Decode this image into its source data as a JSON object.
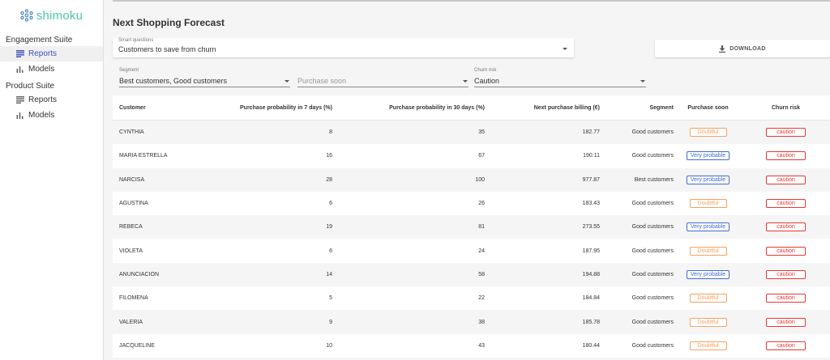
{
  "app": {
    "logo_text": "shimoku"
  },
  "sidebar": {
    "suites": [
      {
        "title": "Engagement Suite",
        "items": [
          {
            "label": "Reports"
          },
          {
            "label": "Models"
          }
        ]
      },
      {
        "title": "Product Suite",
        "items": [
          {
            "label": "Reports"
          },
          {
            "label": "Models"
          }
        ]
      }
    ]
  },
  "page": {
    "title": "Next Shopping Forecast",
    "smart_questions": {
      "label": "Smart questions",
      "value": "Customers to save from churn"
    },
    "download_label": "DOWNLOAD",
    "filters": {
      "segment": {
        "label": "Segment",
        "value": "Best customers, Good customers"
      },
      "purchase_soon": {
        "placeholder": "Purchase soon"
      },
      "churn_risk": {
        "label": "Churn risk",
        "value": "Caution"
      }
    }
  },
  "table": {
    "headers": [
      "Customer",
      "Purchase probability in 7 days (%)",
      "Purchase probability in 30 days (%)",
      "Next purchase billing (€)",
      "Segment",
      "Purchase soon",
      "Churn risk"
    ],
    "rows": [
      [
        "CYNTHIA",
        "8",
        "35",
        "182.77",
        "Good customers",
        "Doubtful",
        "caution"
      ],
      [
        "MARIA ESTRELLA",
        "16",
        "67",
        "190.11",
        "Good customers",
        "Very probable",
        "caution"
      ],
      [
        "NARCISA",
        "28",
        "100",
        "977.87",
        "Best customers",
        "Very probable",
        "caution"
      ],
      [
        "AGUSTINA",
        "6",
        "26",
        "183.43",
        "Good customers",
        "Doubtful",
        "caution"
      ],
      [
        "REBECA",
        "19",
        "81",
        "273.55",
        "Good customers",
        "Very probable",
        "caution"
      ],
      [
        "VIOLETA",
        "6",
        "24",
        "187.95",
        "Good customers",
        "Doubtful",
        "caution"
      ],
      [
        "ANUNCIACION",
        "14",
        "58",
        "194.88",
        "Good customers",
        "Very probable",
        "caution"
      ],
      [
        "FILOMENA",
        "5",
        "22",
        "184.84",
        "Good customers",
        "Doubtful",
        "caution"
      ],
      [
        "VALERIA",
        "9",
        "38",
        "185.78",
        "Good customers",
        "Doubtful",
        "caution"
      ],
      [
        "JACQUELINE",
        "10",
        "43",
        "180.44",
        "Good customers",
        "Doubtful",
        "caution"
      ]
    ]
  },
  "colors": {
    "accent": "#3f51b5",
    "brand": "#4ac6a8",
    "doubtful": "#f4a261",
    "probable": "#3f6bd6",
    "caution": "#e53935"
  }
}
